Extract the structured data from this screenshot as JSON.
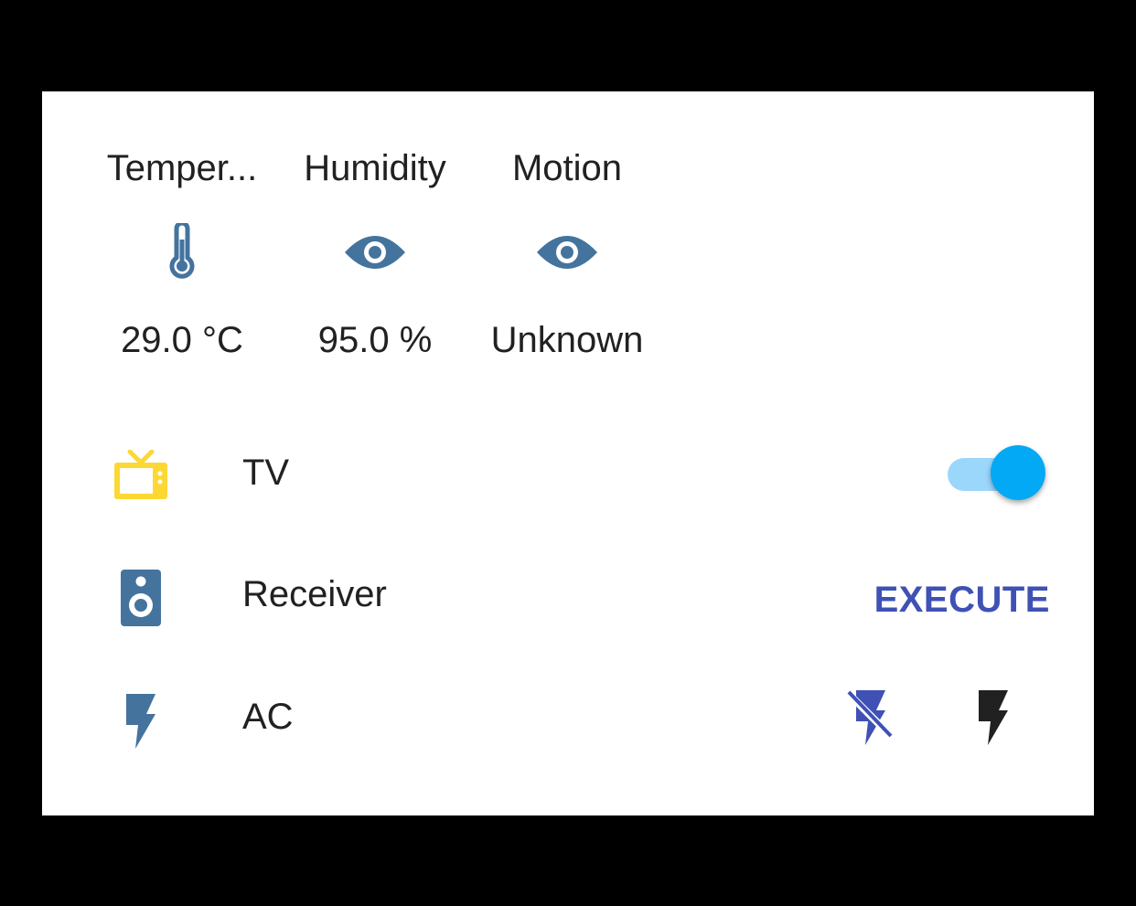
{
  "sensors": [
    {
      "name": "Temper...",
      "value": "29.0 °C",
      "icon": "thermometer-icon"
    },
    {
      "name": "Humidity",
      "value": "95.0 %",
      "icon": "eye-icon"
    },
    {
      "name": "Motion",
      "value": "Unknown",
      "icon": "eye-icon"
    }
  ],
  "rows": {
    "tv": {
      "label": "TV",
      "icon": "television-icon",
      "toggle_on": true
    },
    "receiver": {
      "label": "Receiver",
      "icon": "speaker-icon",
      "action": "EXECUTE"
    },
    "ac": {
      "label": "AC",
      "icon": "flash-icon",
      "buttons": [
        "flash-off-icon",
        "flash-icon"
      ]
    }
  },
  "colors": {
    "icon_default": "#44739e",
    "icon_active": "#fdd835",
    "accent": "#3f51b5",
    "toggle_thumb": "#03a9f4",
    "toggle_track": "#9bd6fb"
  }
}
